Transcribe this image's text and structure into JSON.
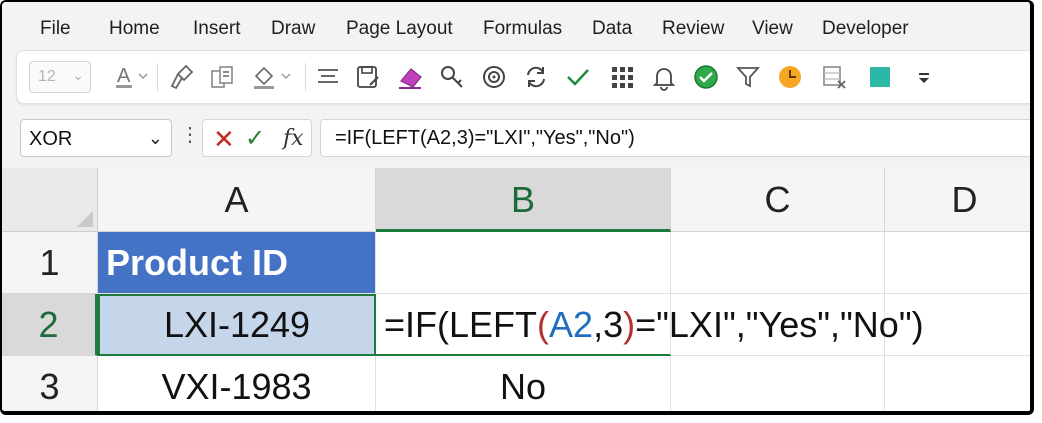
{
  "menu": {
    "items": [
      "File",
      "Home",
      "Insert",
      "Draw",
      "Page Layout",
      "Formulas",
      "Data",
      "Review",
      "View",
      "Developer"
    ]
  },
  "ribbon": {
    "font_size": "12",
    "font_color_letter": "A",
    "icons": [
      "font-color-icon",
      "format-painter-icon",
      "copy-format-icon",
      "fill-color-icon",
      "align-icon",
      "save-as-icon",
      "clear-format-icon",
      "find-icon",
      "target-icon",
      "refresh-icon",
      "checkmark-icon",
      "grid-icon",
      "bell-icon",
      "green-check-icon",
      "filter-icon",
      "clock-icon",
      "delete-sheet-icon",
      "teal-square-icon",
      "customize-icon"
    ],
    "colors": {
      "teal": "#2bb8a6",
      "green": "#1e7b3e",
      "orange": "#f6a623"
    }
  },
  "formula_bar": {
    "name_box": "XOR",
    "cancel_glyph": "✕",
    "enter_glyph": "✓",
    "fx_label": "fx",
    "formula": "=IF(LEFT(A2,3)=\"LXI\",\"Yes\",\"No\")"
  },
  "sheet": {
    "columns": [
      "A",
      "B",
      "C",
      "D"
    ],
    "rows": [
      "1",
      "2",
      "3"
    ],
    "cells": {
      "A1": "Product ID",
      "A2": "LXI-1249",
      "A3": "VXI-1983",
      "B3": "No"
    },
    "editing_formula": {
      "p1": "=IF(LEFT",
      "p2": "(",
      "p3": "A2",
      "p4": ",3",
      "p5": ")",
      "p6": "=\"LXI\",\"Yes\",\"No\")"
    }
  }
}
